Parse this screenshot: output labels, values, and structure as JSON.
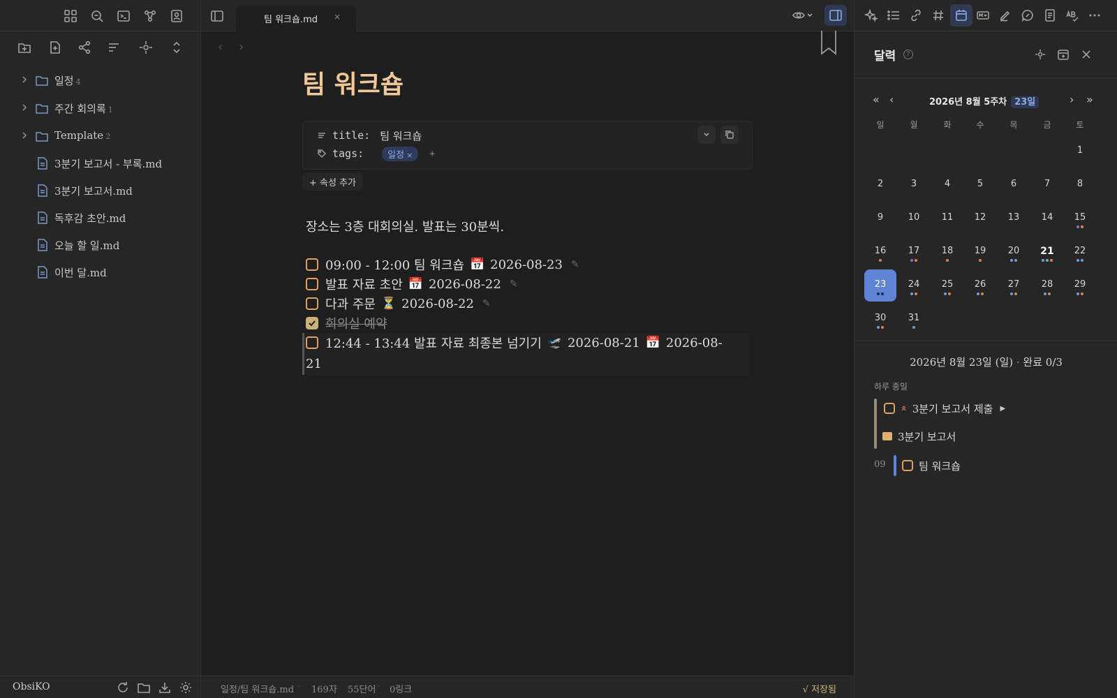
{
  "vault": {
    "name": "ObsiKO"
  },
  "tree": [
    {
      "type": "folder",
      "name": "일정",
      "count": "4"
    },
    {
      "type": "folder",
      "name": "주간 회의록",
      "count": "1"
    },
    {
      "type": "folder",
      "name": "Template",
      "count": "2"
    },
    {
      "type": "file",
      "name": "3분기 보고서 - 부록.md"
    },
    {
      "type": "file",
      "name": "3분기 보고서.md"
    },
    {
      "type": "file",
      "name": "독후감 초안.md"
    },
    {
      "type": "file",
      "name": "오늘 할 일.md"
    },
    {
      "type": "file",
      "name": "이번 달.md"
    }
  ],
  "tab": {
    "title": "팀 워크숍.md",
    "close": "×"
  },
  "nav": {
    "back": "‹",
    "forward": "›"
  },
  "note": {
    "title": "팀 워크숍",
    "properties": {
      "title_key": "title:",
      "title_value": "팀 워크숍",
      "tags_key": "tags:",
      "tag": "일정",
      "tag_remove": "×",
      "tag_add": "+"
    },
    "add_property": "+ 속성 추가",
    "paragraph": "장소는 3층 대회의실. 발표는 30분씩.",
    "tasks": [
      {
        "text": "09:00 - 12:00 팀 워크숍",
        "emoji": "📅",
        "date": "2026-08-23",
        "pen": "✎",
        "done": false
      },
      {
        "text": "발표 자료 초안",
        "emoji": "📅",
        "date": "2026-08-22",
        "pen": "✎",
        "done": false
      },
      {
        "text": "다과 주문",
        "emoji": "⏳",
        "date": "2026-08-22",
        "pen": "✎",
        "done": false
      },
      {
        "text": "회의실 예약",
        "done": true
      }
    ],
    "active_task": {
      "text": "12:44 - 13:44 발표 자료 최종본 넘기기",
      "emoji1": "🛫",
      "date1": "2026-08-21",
      "emoji2": "📅",
      "date2_part1": "2026-08-",
      "date2_part2": "21"
    }
  },
  "status": {
    "path": "일정/팀 워크숍.md",
    "chars": "169자",
    "words": "55단어",
    "links": "0링크",
    "saved": "√ 저장됨",
    "sep": "·"
  },
  "calendar": {
    "title": "달력",
    "help": "?",
    "nav": {
      "prev_year": "«",
      "prev": "‹",
      "next": "›",
      "next_year": "»"
    },
    "month_label": "2026년  8월  5주차",
    "day_chip": "23일",
    "weekdays": [
      "일",
      "월",
      "화",
      "수",
      "목",
      "금",
      "토"
    ],
    "days": [
      {
        "n": "1",
        "col": 6,
        "row": 0,
        "dots": []
      },
      {
        "n": "2",
        "col": 0,
        "row": 1,
        "dots": []
      },
      {
        "n": "3",
        "col": 1,
        "row": 1,
        "dots": []
      },
      {
        "n": "4",
        "col": 2,
        "row": 1,
        "dots": []
      },
      {
        "n": "5",
        "col": 3,
        "row": 1,
        "dots": []
      },
      {
        "n": "6",
        "col": 4,
        "row": 1,
        "dots": []
      },
      {
        "n": "7",
        "col": 5,
        "row": 1,
        "dots": []
      },
      {
        "n": "8",
        "col": 6,
        "row": 1,
        "dots": []
      },
      {
        "n": "9",
        "col": 0,
        "row": 2,
        "dots": []
      },
      {
        "n": "10",
        "col": 1,
        "row": 2,
        "dots": []
      },
      {
        "n": "11",
        "col": 2,
        "row": 2,
        "dots": []
      },
      {
        "n": "12",
        "col": 3,
        "row": 2,
        "dots": []
      },
      {
        "n": "13",
        "col": 4,
        "row": 2,
        "dots": []
      },
      {
        "n": "14",
        "col": 5,
        "row": 2,
        "dots": []
      },
      {
        "n": "15",
        "col": 6,
        "row": 2,
        "dots": [
          "#8a6fd6",
          "#e0804a"
        ]
      },
      {
        "n": "16",
        "col": 0,
        "row": 3,
        "dots": [
          "#e0804a"
        ]
      },
      {
        "n": "17",
        "col": 1,
        "row": 3,
        "dots": [
          "#8a6fd6",
          "#e0804a"
        ]
      },
      {
        "n": "18",
        "col": 2,
        "row": 3,
        "dots": [
          "#e0804a"
        ]
      },
      {
        "n": "19",
        "col": 3,
        "row": 3,
        "dots": [
          "#e0804a"
        ]
      },
      {
        "n": "20",
        "col": 4,
        "row": 3,
        "dots": [
          "#6f9ee0",
          "#6f9ee0"
        ]
      },
      {
        "n": "21",
        "col": 5,
        "row": 3,
        "dots": [
          "#6f9ee0",
          "#5fbf8a",
          "#e0804a"
        ],
        "today": true
      },
      {
        "n": "22",
        "col": 6,
        "row": 3,
        "dots": [
          "#6f9ee0",
          "#6f9ee0"
        ]
      },
      {
        "n": "23",
        "col": 0,
        "row": 4,
        "dots": [
          "#1e2a4a",
          "#1e2a4a"
        ],
        "selected": true
      },
      {
        "n": "24",
        "col": 1,
        "row": 4,
        "dots": [
          "#6f9ee0",
          "#e0804a"
        ]
      },
      {
        "n": "25",
        "col": 2,
        "row": 4,
        "dots": [
          "#6f9ee0",
          "#e0804a"
        ]
      },
      {
        "n": "26",
        "col": 3,
        "row": 4,
        "dots": [
          "#6f9ee0",
          "#e0804a"
        ]
      },
      {
        "n": "27",
        "col": 4,
        "row": 4,
        "dots": [
          "#6f9ee0",
          "#e0804a"
        ]
      },
      {
        "n": "28",
        "col": 5,
        "row": 4,
        "dots": [
          "#6f9ee0",
          "#e0804a"
        ]
      },
      {
        "n": "29",
        "col": 6,
        "row": 4,
        "dots": [
          "#6f9ee0",
          "#e0804a"
        ]
      },
      {
        "n": "30",
        "col": 0,
        "row": 5,
        "dots": [
          "#6f9ee0",
          "#e0804a"
        ]
      },
      {
        "n": "31",
        "col": 1,
        "row": 5,
        "dots": [
          "#6f9ee0"
        ]
      }
    ],
    "summary_date": "2026년 8월 23일 (일)",
    "summary_sep": " · ",
    "summary_done": "완료 0/3",
    "allday_label": "하루 종일",
    "events": {
      "e1_prio": "«",
      "e1": "3분기 보고서 제출",
      "e1_play": "▶",
      "e2": "3분기 보고서",
      "hour": "09",
      "e3": "팀 워크숍"
    }
  },
  "colors": {
    "accent": "#5f84d6",
    "title": "#f0c898",
    "checkbox": "#e0a060"
  }
}
